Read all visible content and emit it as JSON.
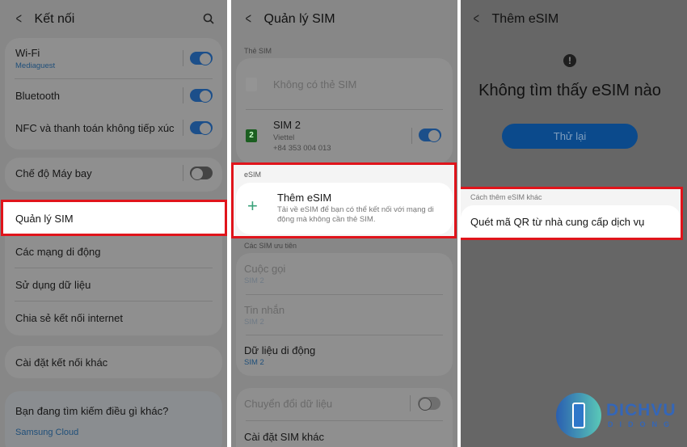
{
  "panel1": {
    "title": "Kết nối",
    "items": [
      {
        "label": "Wi-Fi",
        "sub": "Mediaguest",
        "toggle": true
      },
      {
        "label": "Bluetooth",
        "toggle": true
      },
      {
        "label": "NFC và thanh toán không tiếp xúc",
        "toggle": true
      },
      {
        "label": "Chế độ Máy bay",
        "toggle": false
      },
      {
        "label": "Quản lý SIM",
        "highlighted": true
      },
      {
        "label": "Các mạng di động"
      },
      {
        "label": "Sử dụng dữ liệu"
      },
      {
        "label": "Chia sẻ kết nối internet"
      },
      {
        "label": "Cài đặt kết nối khác"
      }
    ],
    "suggest": {
      "title": "Bạn đang tìm kiếm điều gì khác?",
      "link": "Samsung Cloud"
    }
  },
  "panel2": {
    "title": "Quản lý SIM",
    "sim_section": "Thẻ SIM",
    "no_sim": "Không có thẻ SIM",
    "sim2": {
      "name": "SIM 2",
      "badge": "2",
      "carrier": "Viettel",
      "number": "+84 353 004 013",
      "toggle": true
    },
    "esim_section": "eSIM",
    "add_esim": {
      "title": "Thêm eSIM",
      "desc1": "Tải về eSIM để bạn có thể kết nối với mạng di",
      "desc2": "động mà không cần thẻ SIM."
    },
    "pref_section": "Các SIM ưu tiên",
    "prefs": [
      {
        "label": "Cuộc gọi",
        "sub": "SIM 2"
      },
      {
        "label": "Tin nhắn",
        "sub": "SIM 2"
      },
      {
        "label": "Dữ liệu di động",
        "sub": "SIM 2"
      }
    ],
    "data_switch": {
      "label": "Chuyển đổi dữ liệu",
      "toggle": false
    },
    "other": "Cài đặt SIM khác"
  },
  "panel3": {
    "title": "Thêm eSIM",
    "message": "Không tìm thấy eSIM nào",
    "retry": "Thử lại",
    "other_section": "Cách thêm eSIM khác",
    "scan_qr": "Quét mã QR từ nhà cung cấp dịch vụ"
  },
  "logo": {
    "text1": "DICHVU",
    "text2": "DIDONG"
  },
  "colors": {
    "highlight": "#e0141b",
    "accent": "#1c4f8a",
    "button": "#0b4a8c"
  }
}
